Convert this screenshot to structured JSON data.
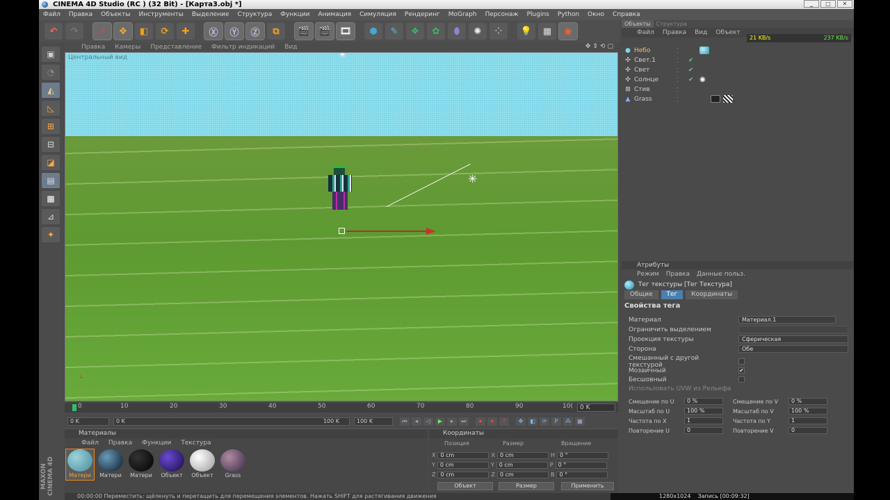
{
  "window": {
    "title": "CINEMA 4D Studio (RC ) (32 Bit) - [Карта3.obj *]"
  },
  "menu": [
    "Файл",
    "Правка",
    "Объекты",
    "Инструменты",
    "Выделение",
    "Структура",
    "Функции",
    "Анимация",
    "Симуляция",
    "Рендеринг",
    "MoGraph",
    "Персонаж",
    "Plugins",
    "Python",
    "Окно",
    "Справка"
  ],
  "viewport": {
    "menu": [
      "Правка",
      "Камеры",
      "Представление",
      "Фильтр индикаций",
      "Вид"
    ],
    "camera_label": "Центральный вид"
  },
  "timeline": {
    "ticks": [
      "0",
      "10",
      "20",
      "30",
      "40",
      "50",
      "60",
      "70",
      "80",
      "90",
      "10("
    ],
    "frame_box": "0 K",
    "start": "0 K",
    "range_left": "0 K",
    "range_right": "100 K",
    "end": "100 K"
  },
  "materials": {
    "title": "Материалы",
    "menu": [
      "Файл",
      "Правка",
      "Функции",
      "Текстура"
    ],
    "items": [
      {
        "label": "Матери",
        "color": "#6fa8b4"
      },
      {
        "label": "Матери",
        "color": "#3a5a8a"
      },
      {
        "label": "Матери",
        "color": "#0a0a0a"
      },
      {
        "label": "Объект",
        "color": "#3a1a8a"
      },
      {
        "label": "Объект",
        "color": "#e8e8e8"
      },
      {
        "label": "Grass",
        "color": "#5a4a6a"
      }
    ]
  },
  "coordinates": {
    "title": "Координаты",
    "headers": [
      "Позиция",
      "Размер",
      "Вращение"
    ],
    "rows": [
      {
        "axis": "X",
        "pos": "0 cm",
        "size_axis": "X",
        "size": "0 cm",
        "rot_axis": "H",
        "rot": "0 °"
      },
      {
        "axis": "Y",
        "pos": "0 cm",
        "size_axis": "Y",
        "size": "0 cm",
        "rot_axis": "P",
        "rot": "0 °"
      },
      {
        "axis": "Z",
        "pos": "0 cm",
        "size_axis": "Z",
        "size": "0 cm",
        "rot_axis": "B",
        "rot": "0 °"
      }
    ],
    "mode": "Объект",
    "size_mode": "Размер",
    "apply": "Применить"
  },
  "status_text": "00:00:00  Переместить: щёлкнуть и перетащить для перемещения элементов. Нажать SHIFT для растягивания движения",
  "objects_panel": {
    "tabs": [
      "Объекты",
      "Структура"
    ],
    "menu": [
      "Файл",
      "Правка",
      "Вид",
      "Объект"
    ],
    "net_in": "21 KB/s",
    "net_out": "237 KB/s",
    "items": [
      {
        "name": "Небо",
        "icon": "sky-icon",
        "color": "#7fd6e8"
      },
      {
        "name": "Свет.1",
        "icon": "light-icon",
        "color": ""
      },
      {
        "name": "Свет",
        "icon": "light-icon",
        "color": ""
      },
      {
        "name": "Солнце",
        "icon": "sun-icon",
        "color": ""
      },
      {
        "name": "Стив",
        "icon": "null-icon",
        "color": ""
      },
      {
        "name": "Grass",
        "icon": "plane-icon",
        "color": ""
      }
    ]
  },
  "attributes": {
    "title": "Атрибуты",
    "menu": [
      "Режим",
      "Правка",
      "Данные польз."
    ],
    "tag_title": "Тег текстуры [Тег Текстура]",
    "tabs": [
      "Общие",
      "Тег",
      "Координаты"
    ],
    "section": "Свойства тега",
    "material_label": "Материал",
    "material_value": "Материал.1",
    "restrict_label": "Ограничить выделением",
    "projection_label": "Проекция текстуры",
    "projection_value": "Сферическая",
    "side_label": "Сторона",
    "side_value": "Обе",
    "mix_label": "Смешанный с другой текстурой",
    "tile_label": "Мозаичный",
    "seamless_label": "Бесшовный",
    "uvw_label": "Использовать UVW из Рельефа",
    "offset_u": {
      "label": "Смещение по U",
      "value": "0 %"
    },
    "offset_v": {
      "label": "Смещение по V",
      "value": "0 %"
    },
    "scale_u": {
      "label": "Масштаб по U",
      "value": "100 %"
    },
    "scale_v": {
      "label": "Масштаб по V",
      "value": "100 %"
    },
    "freq_x": {
      "label": "Частота по X",
      "value": "1"
    },
    "freq_y": {
      "label": "Частота по Y",
      "value": "1"
    },
    "repeat_u": {
      "label": "Повторение U",
      "value": "0"
    },
    "repeat_v": {
      "label": "Повторение V",
      "value": "0"
    }
  },
  "taskbar": {
    "res": "1280x1024",
    "rec": "Запись [00:09:32]"
  }
}
